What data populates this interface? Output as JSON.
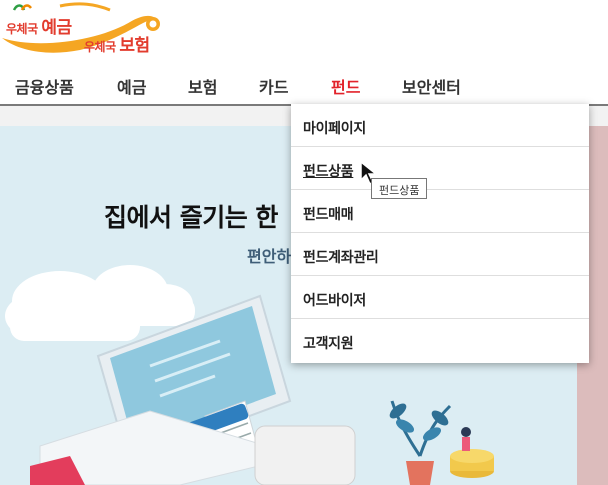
{
  "brand": {
    "logo_text_1_small": "우체국",
    "logo_text_1_big": "예금",
    "logo_text_2_small": "우체국",
    "logo_text_2_big": "보험",
    "accent_color": "#e2232b",
    "swoosh_color": "#f5a623"
  },
  "nav": {
    "items": [
      {
        "label": "금융상품"
      },
      {
        "label": "예금"
      },
      {
        "label": "보험"
      },
      {
        "label": "카드"
      },
      {
        "label": "펀드"
      },
      {
        "label": "보안센터"
      }
    ],
    "active": "펀드"
  },
  "banner": {
    "title": "집에서 즐기는 한",
    "subtitle": "편안하",
    "background_color": "#dcedf3"
  },
  "dropdown": {
    "items": [
      {
        "label": "마이페이지"
      },
      {
        "label": "펀드상품"
      },
      {
        "label": "펀드매매"
      },
      {
        "label": "펀드계좌관리"
      },
      {
        "label": "어드바이저"
      },
      {
        "label": "고객지원"
      }
    ],
    "hovered": "펀드상품"
  },
  "tooltip": {
    "text": "펀드상품"
  }
}
